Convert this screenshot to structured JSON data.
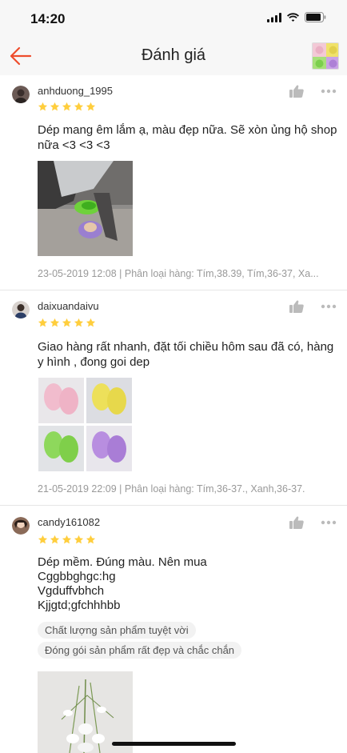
{
  "status_bar": {
    "time": "14:20"
  },
  "nav": {
    "title": "Đánh giá"
  },
  "colors": {
    "accent": "#ee4d2d",
    "star": "#ffce3d",
    "meta": "#999999"
  },
  "reviews": [
    {
      "username": "anhduong_1995",
      "rating": 5,
      "text": "Dép mang êm lắm ạ, màu đẹp nữa. Sẽ xòn ủng hộ shop nữa <3 <3 <3",
      "meta": "23-05-2019 12:08 | Phân loại hàng: Tím,38.39, Tím,36-37, Xa..."
    },
    {
      "username": "daixuandaivu",
      "rating": 5,
      "text": "Giao hàng rất nhanh, đặt tối chiều hôm sau đã có, hàng y hình , đong goi dep",
      "meta": "21-05-2019 22:09 | Phân loại hàng: Tím,36-37., Xanh,36-37."
    },
    {
      "username": "candy161082",
      "rating": 5,
      "text_lines": [
        "Dép mềm. Đúng màu. Nên mua",
        "Cggbbghgc:hg",
        "Vgduffvbhch",
        "Kjjgtd;gfchhhbb"
      ],
      "tags": [
        "Chất lượng sản phẩm tuyệt vời",
        "Đóng gói sản phẩm rất đẹp và chắc chắn"
      ]
    }
  ],
  "icons": {
    "back": "arrow-left-icon",
    "like": "thumbs-up-icon",
    "more": "more-horizontal-icon",
    "star": "star-icon"
  }
}
